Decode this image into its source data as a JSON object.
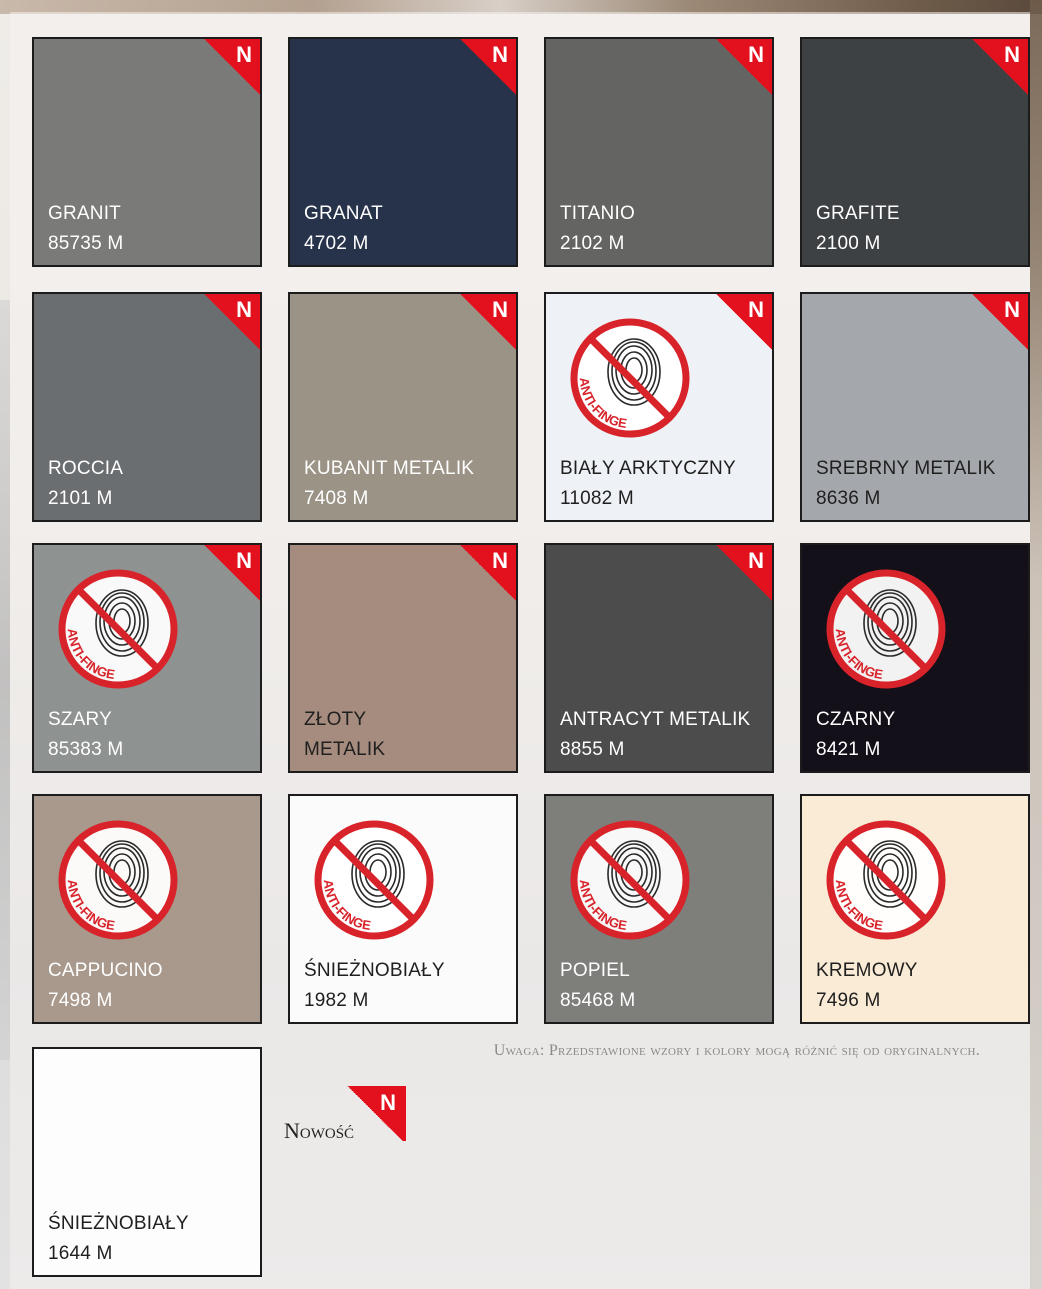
{
  "swatches": [
    {
      "name": "GRANIT",
      "code": "85735 M",
      "color": "#7a7a78",
      "new": true,
      "af": false,
      "dark": true
    },
    {
      "name": "GRANAT",
      "code": "4702 M",
      "color": "#27334a",
      "new": true,
      "af": false,
      "dark": true
    },
    {
      "name": "TITANIO",
      "code": "2102 M",
      "color": "#646462",
      "new": true,
      "af": false,
      "dark": true
    },
    {
      "name": "GRAFITE",
      "code": "2100 M",
      "color": "#3e4144",
      "new": true,
      "af": false,
      "dark": true
    },
    {
      "name": "ROCCIA",
      "code": "2101 M",
      "color": "#6b6e71",
      "new": true,
      "af": false,
      "dark": true
    },
    {
      "name": "KUBANIT METALIK",
      "code": "7408 M",
      "color": "#9a9386",
      "new": true,
      "af": false,
      "dark": true
    },
    {
      "name": "BIAŁY ARKTYCZNY",
      "code": "11082 M",
      "color": "#eef1f6",
      "new": true,
      "af": true,
      "dark": false
    },
    {
      "name": "SREBRNY METALIK",
      "code": "8636 M",
      "color": "#a4a8ac",
      "new": true,
      "af": false,
      "dark": false
    },
    {
      "name": "SZARY",
      "code": "85383 M",
      "color": "#8e9290",
      "new": true,
      "af": true,
      "dark": true
    },
    {
      "name": "ZŁOTY METALIK",
      "code": "",
      "color": "#a58c7e",
      "new": true,
      "af": false,
      "dark": false
    },
    {
      "name": "ANTRACYT METALIK",
      "code": "8855 M",
      "color": "#4c4c4c",
      "new": true,
      "af": false,
      "dark": true
    },
    {
      "name": "CZARNY",
      "code": "8421 M",
      "color": "#14101a",
      "new": false,
      "af": true,
      "dark": true
    },
    {
      "name": "CAPPUCINO",
      "code": "7498 M",
      "color": "#a8998c",
      "new": false,
      "af": true,
      "dark": true
    },
    {
      "name": "ŚNIEŻNOBIAŁY",
      "code": "1982 M",
      "color": "#fbfbfb",
      "new": false,
      "af": true,
      "dark": false
    },
    {
      "name": "POPIEL",
      "code": "85468 M",
      "color": "#7e7f7a",
      "new": false,
      "af": true,
      "dark": true
    },
    {
      "name": "KREMOWY",
      "code": "7496 M",
      "color": "#f9ebd6",
      "new": false,
      "af": true,
      "dark": false
    },
    {
      "name": "ŚNIEŻNOBIAŁY",
      "code": "1644 M",
      "color": "#fdfdfd",
      "new": false,
      "af": false,
      "dark": false
    }
  ],
  "badge_letter": "N",
  "af_text": "ANTI-FINGERPRINT",
  "note": "Uwaga: Przedstawione wzory i kolory mogą różnić się od oryginalnych.",
  "legend": {
    "letter": "N",
    "label": "Nowość"
  },
  "colors": {
    "badge": "#e3101d",
    "af_ring": "#d8232a"
  }
}
